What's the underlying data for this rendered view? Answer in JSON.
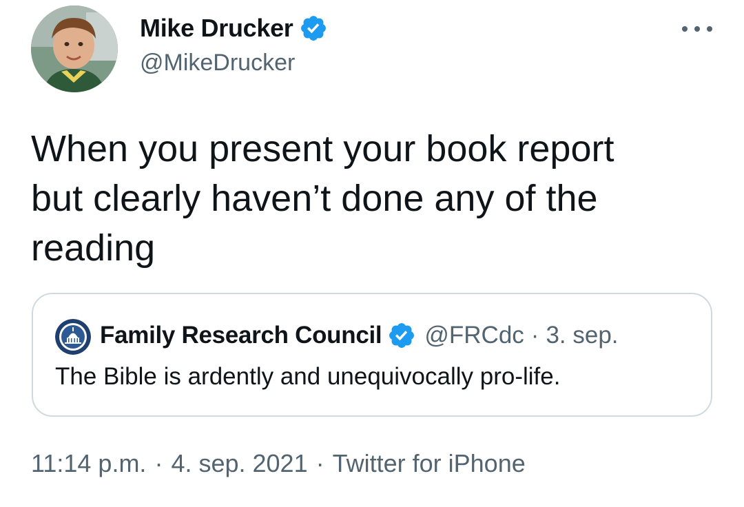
{
  "author": {
    "display_name": "Mike Drucker",
    "handle": "@MikeDrucker",
    "verified": true,
    "avatar_icon": "child-photo-avatar"
  },
  "tweet": {
    "text": "When you present your book report\nbut clearly haven’t done any of the\nreading"
  },
  "quoted_tweet": {
    "display_name": "Family Research Council",
    "handle": "@FRCdc",
    "separator": "·",
    "date": "3. sep.",
    "verified": true,
    "text": "The Bible is ardently and unequivocally pro-life.",
    "avatar_icon": "capitol-dome-logo"
  },
  "meta": {
    "time": "11:14 p.m.",
    "separator": "·",
    "date": "4. sep. 2021",
    "source": "Twitter for iPhone"
  },
  "colors": {
    "verified_blue": "#1d9bf0",
    "secondary_text": "#536471",
    "border": "#cfd9de"
  }
}
